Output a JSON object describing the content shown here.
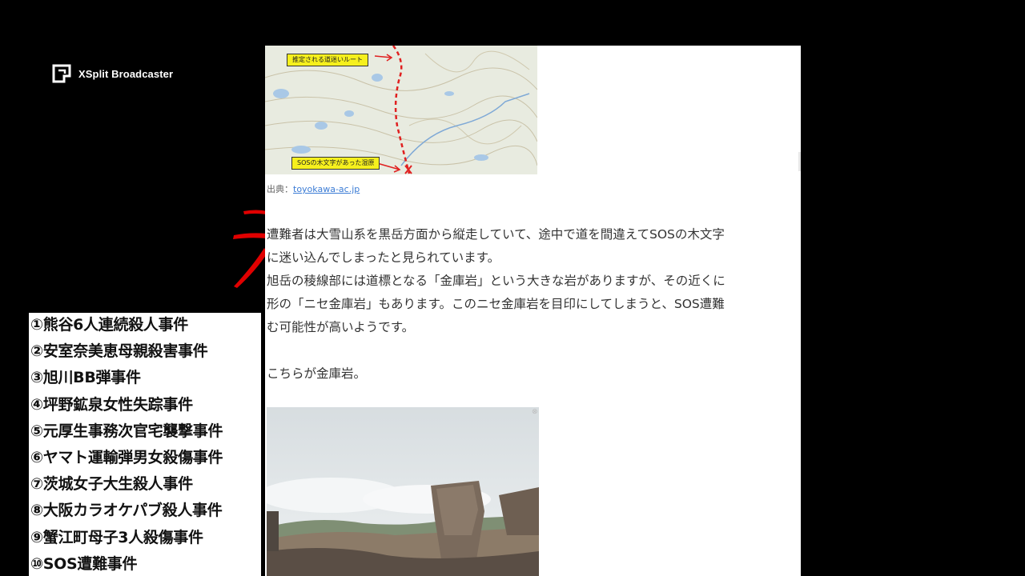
{
  "broadcaster": {
    "name": "XSplit Broadcaster",
    "logo_icon": "xsplit-logo-icon"
  },
  "map": {
    "label_top": "推定される道迷いルート",
    "label_bottom": "SOSの木文字があった湿原",
    "route_color": "#e02020",
    "label_color": "#f6f01d"
  },
  "caption": {
    "prefix": "出典：",
    "link_text": "toyokawa-ac.jp"
  },
  "article": {
    "line1": "遭難者は大雪山系を黒岳方面から縦走していて、途中で道を間違えてSOSの木文字",
    "line2": "に迷い込んでしまったと見られています。",
    "line3": "旭岳の稜線部には道標となる「金庫岩」という大きな岩がありますが、その近くに",
    "line4": "形の「ニセ金庫岩」もあります。このニセ金庫岩を目印にしてしまうと、SOS遭難",
    "line5": "む可能性が高いようです。",
    "line6": "こちらが金庫岩。"
  },
  "photo": {
    "close_icon": "close-icon",
    "close_glyph": "⊗"
  },
  "case_list": {
    "items": [
      "①熊谷6人連続殺人事件",
      "②安室奈美恵母親殺害事件",
      "③旭川BB弾事件",
      "④坪野鉱泉女性失踪事件",
      "⑤元厚生事務次官宅襲撃事件",
      "⑥ヤマト運輸弾男女殺傷事件",
      "⑦茨城女子大生殺人事件",
      "⑧大阪カラオケパブ殺人事件",
      "⑨蟹江町母子3人殺傷事件",
      "⑩SOS遭難事件"
    ]
  },
  "colors": {
    "background": "#000000",
    "accent_red": "#e00000",
    "link": "#3a7bd5"
  }
}
